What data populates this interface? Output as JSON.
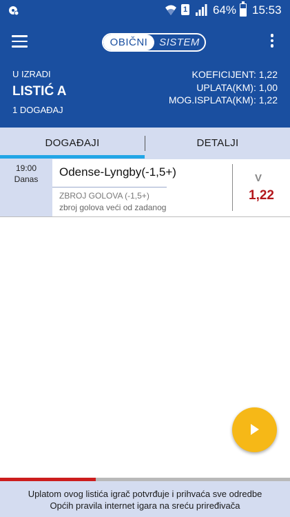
{
  "status_bar": {
    "battery_percent": "64%",
    "battery_level": 0.64,
    "time": "15:53",
    "sim_label": "1",
    "icons": [
      "notification-icon",
      "wifi-icon",
      "sim-icon",
      "signal-icon",
      "battery-icon"
    ]
  },
  "app_bar": {
    "mode_tabs": {
      "active": "OBIČNI",
      "inactive": "SISTEM"
    },
    "icons": {
      "menu": "hamburger-menu-icon",
      "more": "more-vertical-icon"
    }
  },
  "ticket": {
    "status": "U IZRADI",
    "title": "LISTIĆ A",
    "event_count": "1 DOGAĐAJ",
    "summary": {
      "coefficient": "KOEFICIJENT: 1,22",
      "stake": "UPLATA(KM): 1,00",
      "possible_payout": "MOG.ISPLATA(KM): 1,22"
    }
  },
  "tabs": {
    "events": "DOGAĐAJI",
    "details": "DETALJI"
  },
  "events": [
    {
      "time": "19:00",
      "day": "Danas",
      "match": "Odense-Lyngby(-1,5+)",
      "market": "ZBROJ GOLOVA (-1,5+)",
      "market_description": "zbroj golova veći od zadanog",
      "pick": "V",
      "odds": "1,22"
    }
  ],
  "fab": {
    "icon": "play-icon"
  },
  "progress": {
    "value": 0.33
  },
  "footer": {
    "text": "Uplatom ovog listića igrač potvrđuje i prihvaća sve odredbe Općih pravila internet igara na sreću priređivača"
  },
  "colors": {
    "primary": "#1a4fa0",
    "light_panel": "#d4dcf0",
    "tab_indicator": "#22a6e6",
    "odds_red": "#b3161b",
    "fab": "#f6b817",
    "progress_red": "#cc1d1d"
  }
}
